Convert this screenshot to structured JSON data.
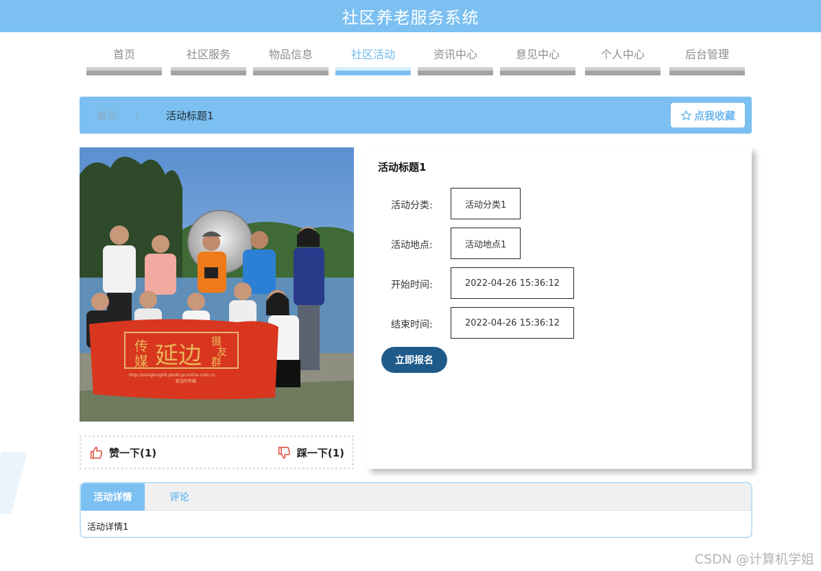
{
  "header": {
    "title": "社区养老服务系统"
  },
  "nav": {
    "items": [
      {
        "label": "首页",
        "active": false
      },
      {
        "label": "社区服务",
        "active": false
      },
      {
        "label": "物品信息",
        "active": false
      },
      {
        "label": "社区活动",
        "active": true
      },
      {
        "label": "资讯中心",
        "active": false
      },
      {
        "label": "意见中心",
        "active": false
      },
      {
        "label": "个人中心",
        "active": false
      },
      {
        "label": "后台管理",
        "active": false
      }
    ]
  },
  "breadcrumb": {
    "home": "首页",
    "separator": "/",
    "current": "活动标题1"
  },
  "favorite": {
    "label": "点我收藏",
    "icon": "star-outline-icon"
  },
  "photo": {
    "banner_main": "延边",
    "banner_left_top": "传",
    "banner_left_bottom": "媒",
    "banner_right_top": "摄",
    "banner_right_mid": "友",
    "banner_right_bottom": "群",
    "banner_url": "http://xianglong69.photo.pconline.com.cn",
    "banner_sub": "延边的传媒"
  },
  "votes": {
    "like_label": "赞一下(1)",
    "dislike_label": "踩一下(1)",
    "like_icon": "thumbs-up-icon",
    "dislike_icon": "thumbs-down-icon"
  },
  "detail": {
    "title": "活动标题1",
    "fields": [
      {
        "label": "活动分类:",
        "value": "活动分类1"
      },
      {
        "label": "活动地点:",
        "value": "活动地点1"
      },
      {
        "label": "开始时间:",
        "value": "2022-04-26 15:36:12"
      },
      {
        "label": "结束时间:",
        "value": "2022-04-26 15:36:12"
      }
    ],
    "signup_label": "立即报名"
  },
  "tabs": {
    "items": [
      {
        "label": "活动详情",
        "active": true
      },
      {
        "label": "评论",
        "active": false
      }
    ],
    "content": "活动详情1"
  },
  "watermark": "CSDN @计算机学姐",
  "colors": {
    "primary": "#7cc0f2",
    "button": "#1e5a8a",
    "icon_red": "#e04a3a"
  }
}
